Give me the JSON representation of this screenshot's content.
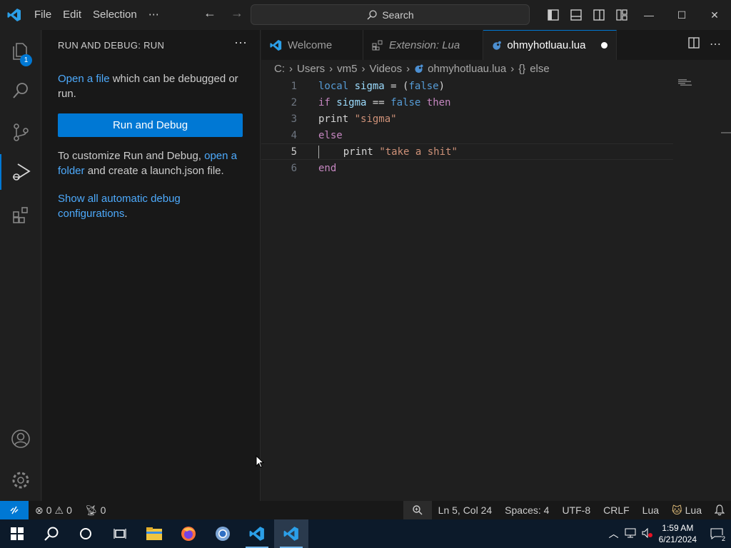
{
  "titlebar": {
    "menu": [
      "File",
      "Edit",
      "Selection",
      "⋯"
    ],
    "search_label": "Search"
  },
  "activity": {
    "explorer_badge": "1"
  },
  "sidebar": {
    "title": "RUN AND DEBUG: RUN",
    "open_file_link": "Open a file",
    "open_file_rest": " which can be debugged or run.",
    "run_button": "Run and Debug",
    "customize_prefix": "To customize Run and Debug, ",
    "open_folder_link": "open a folder",
    "customize_suffix": " and create a launch.json file.",
    "show_all_link": "Show all automatic debug configurations",
    "show_all_suffix": "."
  },
  "tabs": [
    {
      "label": "Welcome"
    },
    {
      "label": "Extension: Lua"
    },
    {
      "label": "ohmyhotluau.lua"
    }
  ],
  "breadcrumbs": [
    "C:",
    "Users",
    "vm5",
    "Videos",
    "ohmyhotluau.lua",
    "else"
  ],
  "code": {
    "line_numbers": [
      "1",
      "2",
      "3",
      "4",
      "5",
      "6"
    ],
    "l1": {
      "a": "local",
      "b": "sigma",
      "c": " = (",
      "d": "false",
      "e": ")"
    },
    "l2": {
      "a": "if",
      "b": "sigma",
      "c": " == ",
      "d": "false",
      "e": "then"
    },
    "l3": {
      "a": "print",
      "b": "\"sigma\""
    },
    "l4": {
      "a": "else"
    },
    "l5": {
      "a": "print",
      "b": "\"take a shit\""
    },
    "l6": {
      "a": "end"
    }
  },
  "status": {
    "errors": "0",
    "warnings": "0",
    "ports": "0",
    "position": "Ln 5, Col 24",
    "spaces": "Spaces: 4",
    "encoding": "UTF-8",
    "eol": "CRLF",
    "language": "Lua",
    "lua_ext": "Lua"
  },
  "taskbar": {
    "time": "1:59 AM",
    "date": "6/21/2024",
    "notifications": "2"
  },
  "colors": {
    "accent": "#0078d4",
    "link": "#4daafc"
  }
}
